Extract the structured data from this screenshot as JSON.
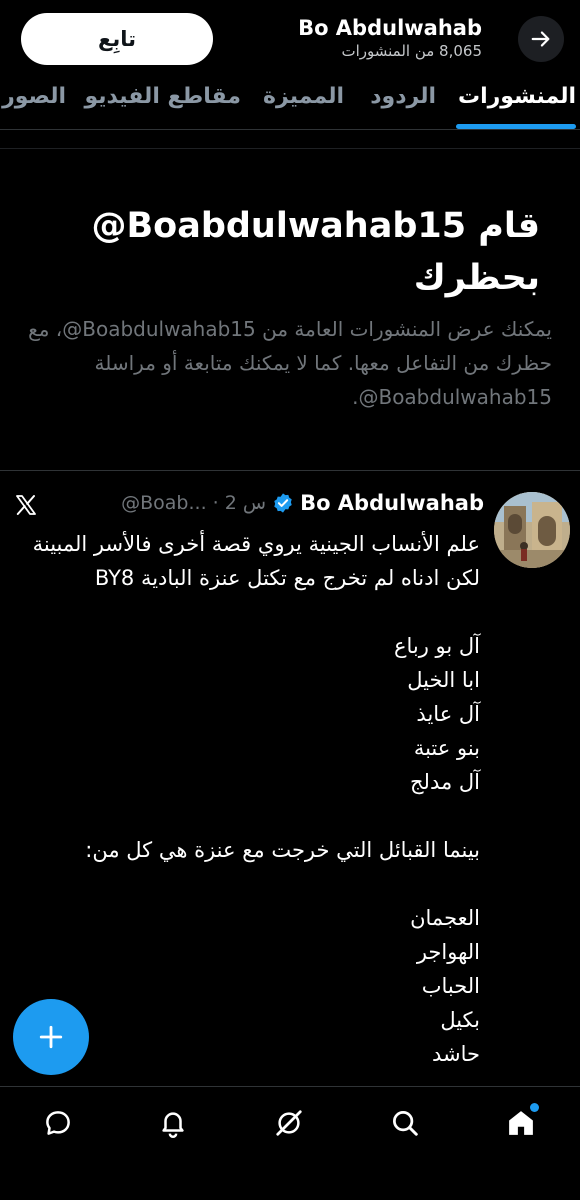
{
  "header": {
    "profile_name": "Bo Abdulwahab",
    "posts_count": "8,065 من المنشورات",
    "follow_label": "تابِع"
  },
  "tabs": [
    {
      "label": "المنشورات",
      "active": true
    },
    {
      "label": "الردود"
    },
    {
      "label": "المميزة"
    },
    {
      "label": "مقاطع الفيديو"
    },
    {
      "label": "الصور"
    }
  ],
  "blocked": {
    "title": "قام ‎@Boabdulwahab15‏ بحظرك",
    "description": "يمكنك عرض المنشورات العامة من ‎@Boabdulwahab15‏، مع حظرك من التفاعل معها. كما لا يمكنك متابعة أو مراسلة ‎@Boabdulwahab15‏."
  },
  "tweet": {
    "author_name": "Bo Abdulwahab",
    "handle_time": "@Boab... · 2 س",
    "lines": [
      "علم الأنساب الجينية يروي قصة أخرى فالأسر المبينة لكن ادناه لم تخرج مع تكتل عنزة البادية BY8",
      "",
      "آل بو رباع",
      "ابا الخيل",
      "آل عايذ",
      "بنو عتبة",
      "آل مدلج",
      "",
      "بينما القبائل التي خرجت مع عنزة هي كل من:",
      "",
      "العجمان",
      "الهواجر",
      "الحباب",
      "بكيل",
      "حاشد"
    ]
  },
  "icons": {
    "back": "arrow-right-icon",
    "verified": "verified-badge-icon",
    "x": "x-logo-icon",
    "compose": "plus-icon",
    "nav": [
      "messages-icon",
      "notifications-icon",
      "grok-icon",
      "search-icon",
      "home-icon"
    ]
  },
  "colors": {
    "background": "#000000",
    "accent": "#1d9bf0",
    "muted_text": "#71767b",
    "primary_text": "#ffffff"
  }
}
